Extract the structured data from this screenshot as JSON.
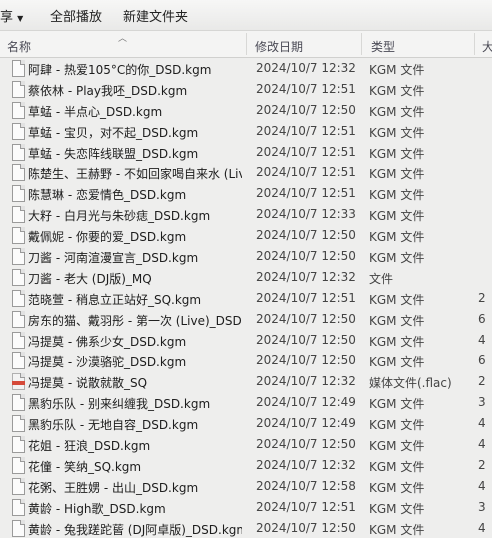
{
  "toolbar": {
    "share_label": "享",
    "share_arrow": "▼",
    "play_all_label": "全部播放",
    "new_folder_label": "新建文件夹"
  },
  "columns": {
    "name": "名称",
    "modified": "修改日期",
    "type": "类型",
    "size": "大"
  },
  "files": [
    {
      "name": "阿肆 - 热爱105°C的你_DSD.kgm",
      "date": "2024/10/7 12:32",
      "type": "KGM 文件",
      "size": "",
      "icon": "file-icon"
    },
    {
      "name": "蔡依林 - Play我呸_DSD.kgm",
      "date": "2024/10/7 12:51",
      "type": "KGM 文件",
      "size": "",
      "icon": "file-icon"
    },
    {
      "name": "草蜢 - 半点心_DSD.kgm",
      "date": "2024/10/7 12:50",
      "type": "KGM 文件",
      "size": "",
      "icon": "file-icon"
    },
    {
      "name": "草蜢 - 宝贝，对不起_DSD.kgm",
      "date": "2024/10/7 12:51",
      "type": "KGM 文件",
      "size": "",
      "icon": "file-icon"
    },
    {
      "name": "草蜢 - 失恋阵线联盟_DSD.kgm",
      "date": "2024/10/7 12:51",
      "type": "KGM 文件",
      "size": "",
      "icon": "file-icon"
    },
    {
      "name": "陈楚生、王赫野 - 不如回家喝自来水 (Liv...",
      "date": "2024/10/7 12:51",
      "type": "KGM 文件",
      "size": "",
      "icon": "file-icon"
    },
    {
      "name": "陈慧琳 - 恋爱情色_DSD.kgm",
      "date": "2024/10/7 12:51",
      "type": "KGM 文件",
      "size": "",
      "icon": "file-icon"
    },
    {
      "name": "大籽 - 白月光与朱砂痣_DSD.kgm",
      "date": "2024/10/7 12:33",
      "type": "KGM 文件",
      "size": "",
      "icon": "file-icon"
    },
    {
      "name": "戴佩妮 - 你要的爱_DSD.kgm",
      "date": "2024/10/7 12:50",
      "type": "KGM 文件",
      "size": "",
      "icon": "file-icon"
    },
    {
      "name": "刀酱 - 河南渲漫宣言_DSD.kgm",
      "date": "2024/10/7 12:50",
      "type": "KGM 文件",
      "size": "",
      "icon": "file-icon"
    },
    {
      "name": "刀酱 - 老大 (DJ版)_MQ",
      "date": "2024/10/7 12:32",
      "type": "文件",
      "size": "",
      "icon": "file-icon"
    },
    {
      "name": "范晓萱 - 稍息立正站好_SQ.kgm",
      "date": "2024/10/7 12:51",
      "type": "KGM 文件",
      "size": "2",
      "icon": "file-icon"
    },
    {
      "name": "房东的猫、戴羽彤 - 第一次 (Live)_DSD...",
      "date": "2024/10/7 12:50",
      "type": "KGM 文件",
      "size": "6",
      "icon": "file-icon"
    },
    {
      "name": "冯提莫 - 佛系少女_DSD.kgm",
      "date": "2024/10/7 12:50",
      "type": "KGM 文件",
      "size": "4",
      "icon": "file-icon"
    },
    {
      "name": "冯提莫 - 沙漠骆驼_DSD.kgm",
      "date": "2024/10/7 12:50",
      "type": "KGM 文件",
      "size": "6",
      "icon": "file-icon"
    },
    {
      "name": "冯提莫 - 说散就散_SQ",
      "date": "2024/10/7 12:32",
      "type": "媒体文件(.flac)",
      "size": "2",
      "icon": "flac-file-icon"
    },
    {
      "name": "黑豹乐队 - 别来纠缠我_DSD.kgm",
      "date": "2024/10/7 12:49",
      "type": "KGM 文件",
      "size": "3",
      "icon": "file-icon"
    },
    {
      "name": "黑豹乐队 - 无地自容_DSD.kgm",
      "date": "2024/10/7 12:49",
      "type": "KGM 文件",
      "size": "4",
      "icon": "file-icon"
    },
    {
      "name": "花姐 - 狂浪_DSD.kgm",
      "date": "2024/10/7 12:50",
      "type": "KGM 文件",
      "size": "4",
      "icon": "file-icon"
    },
    {
      "name": "花僮 - 笑纳_SQ.kgm",
      "date": "2024/10/7 12:32",
      "type": "KGM 文件",
      "size": "2",
      "icon": "file-icon"
    },
    {
      "name": "花粥、王胜娚 - 出山_DSD.kgm",
      "date": "2024/10/7 12:58",
      "type": "KGM 文件",
      "size": "4",
      "icon": "file-icon"
    },
    {
      "name": "黄龄 - High歌_DSD.kgm",
      "date": "2024/10/7 12:51",
      "type": "KGM 文件",
      "size": "3",
      "icon": "file-icon"
    },
    {
      "name": "黄龄 - 兔我蹉跎蒈 (DJ阿卓版)_DSD.kgm",
      "date": "2024/10/7 12:50",
      "type": "KGM 文件",
      "size": "4",
      "icon": "file-icon"
    }
  ]
}
